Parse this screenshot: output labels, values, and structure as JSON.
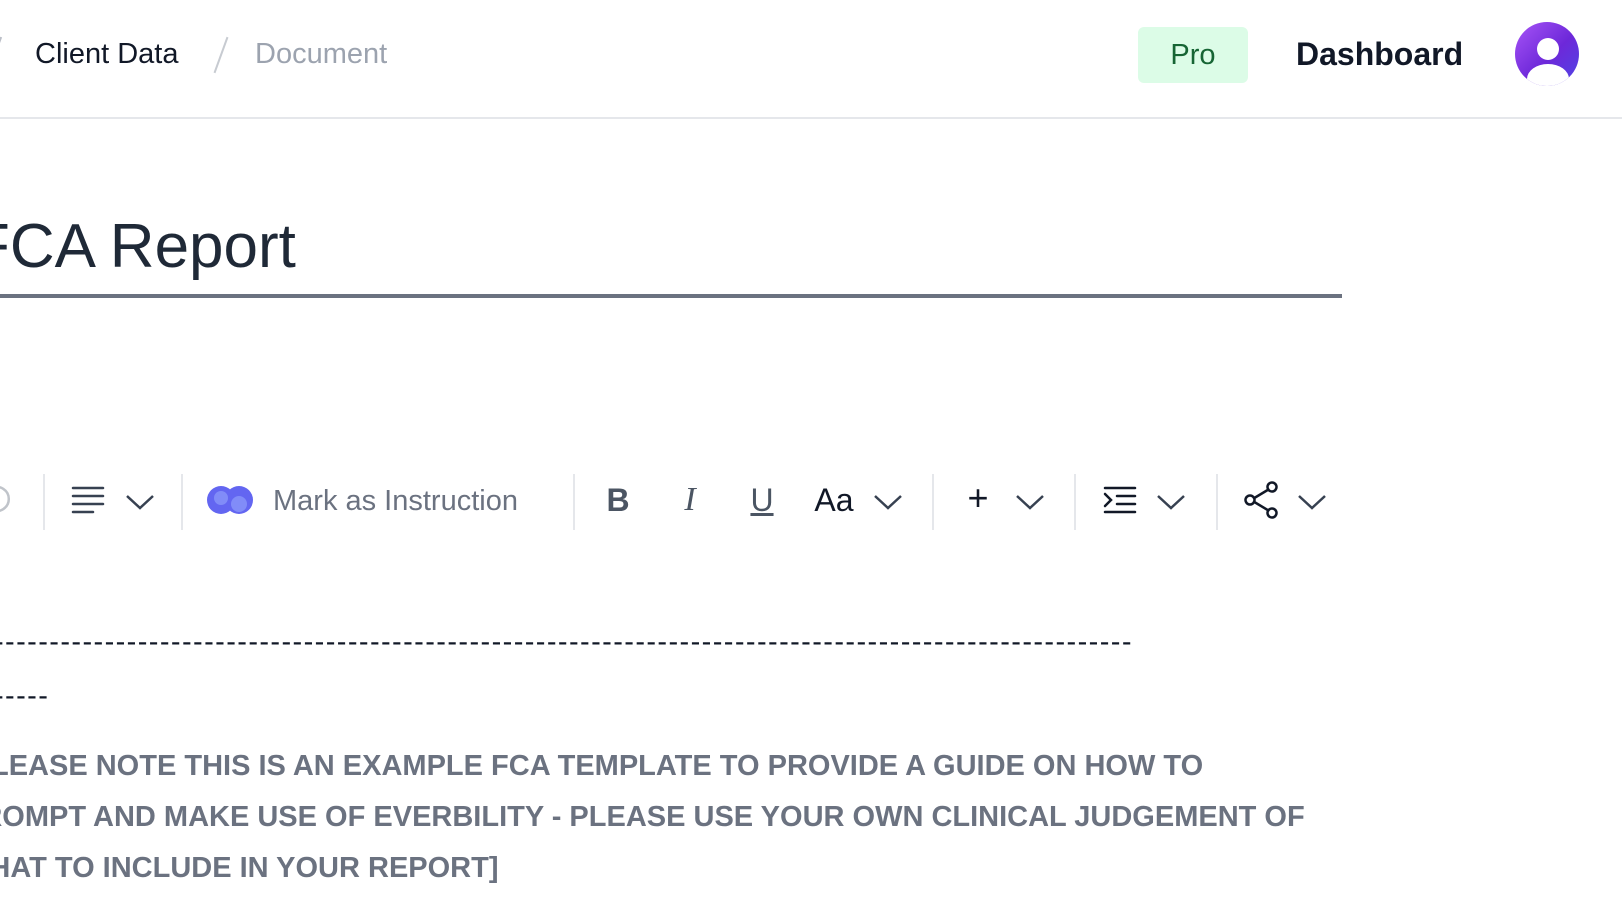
{
  "breadcrumb": {
    "items": [
      "Client Data",
      "Document"
    ]
  },
  "header": {
    "plan_badge": "Pro",
    "dashboard_label": "Dashboard"
  },
  "document": {
    "title": "FCA Report"
  },
  "toolbar": {
    "mark_instruction_label": "Mark as Instruction",
    "bold_label": "B",
    "italic_label": "I",
    "underline_label": "U",
    "font_size_label": "Aa",
    "insert_label": "+"
  },
  "content": {
    "divider_line_1": "-------------------------------------------------------------------------------------------------------",
    "divider_line_2": "-----",
    "note_text": "[PLEASE NOTE THIS IS AN EXAMPLE FCA TEMPLATE TO PROVIDE A GUIDE ON HOW TO PROMPT AND MAKE USE OF EVERBILITY - PLEASE USE YOUR OWN CLINICAL JUDGEMENT OF WHAT TO INCLUDE IN YOUR REPORT]"
  },
  "colors": {
    "accent": "#6366f1",
    "pro_bg": "#dcfce7",
    "pro_text": "#166534"
  }
}
